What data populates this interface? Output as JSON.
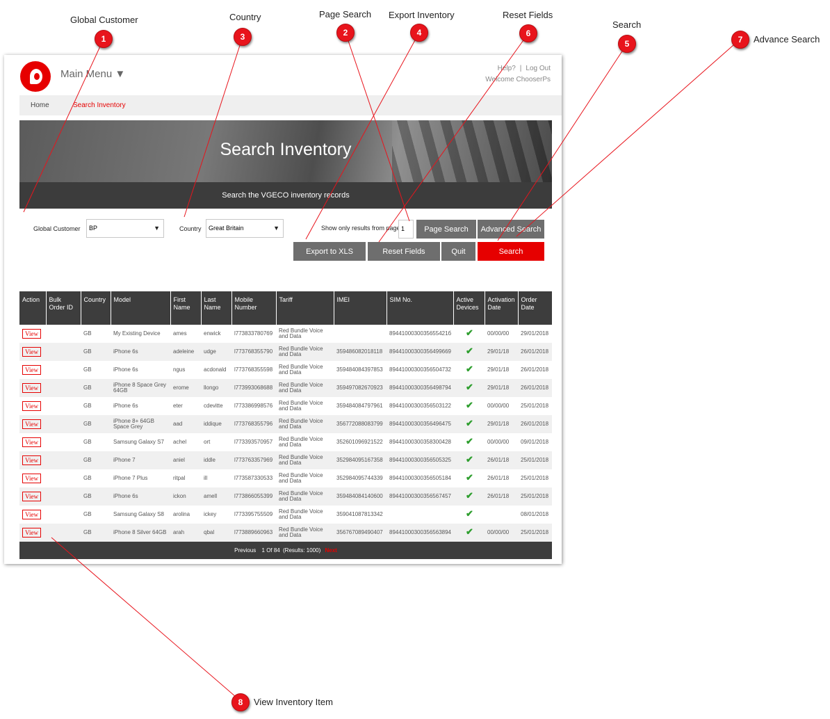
{
  "annotations": [
    {
      "num": "1",
      "label": "Global Customer"
    },
    {
      "num": "2",
      "label": "Page Search"
    },
    {
      "num": "3",
      "label": "Country"
    },
    {
      "num": "4",
      "label": "Export Inventory"
    },
    {
      "num": "5",
      "label": "Search"
    },
    {
      "num": "6",
      "label": "Reset Fields"
    },
    {
      "num": "7",
      "label": "Advance Search"
    },
    {
      "num": "8",
      "label": "View Inventory Item"
    }
  ],
  "header": {
    "main_menu": "Main Menu ▼",
    "help": "Help?",
    "separator": "|",
    "logout": "Log Out",
    "welcome": "Welcome ChooserPs"
  },
  "breadcrumb": {
    "home": "Home",
    "current": "Search Inventory"
  },
  "banner": {
    "title": "Search Inventory",
    "subtitle": "Search the VGECO inventory records"
  },
  "filters": {
    "global_customer_label": "Global Customer",
    "global_customer_value": "BP",
    "country_label": "Country",
    "country_value": "Great Britain",
    "page_label": "Show only results from page",
    "page_value": "1",
    "dropdown_arrow": "▼"
  },
  "buttons": {
    "page_search": "Page Search",
    "advanced_search": "Advanced Search",
    "export": "Export to XLS",
    "reset": "Reset Fields",
    "quit": "Quit",
    "search": "Search"
  },
  "table": {
    "headers": [
      "Action",
      "Bulk Order ID",
      "Country",
      "Model",
      "First Name",
      "Last Name",
      "Mobile Number",
      "Tariff",
      "IMEI",
      "SIM No.",
      "Active Devices",
      "Activation Date",
      "Order Date"
    ],
    "view_label": "View",
    "check_glyph": "✔",
    "rows": [
      {
        "bulk": "",
        "country": "GB",
        "model": "My Existing Device",
        "first": "ames",
        "last": "enwick",
        "mobile": "l773833780769",
        "tariff": "Red Bundle Voice and Data",
        "imei": "",
        "sim": "8944100030035655421б",
        "activation": "00/00/00",
        "order": "29/01/2018"
      },
      {
        "bulk": "",
        "country": "GB",
        "model": "iPhone 6s",
        "first": "adeleine",
        "last": "udge",
        "mobile": "l773768355790",
        "tariff": "Red Bundle Voice and Data",
        "imei": "359486082018118",
        "sim": "89441000300356499669",
        "activation": "29/01/18",
        "order": "26/01/2018"
      },
      {
        "bulk": "",
        "country": "GB",
        "model": "iPhone 6s",
        "first": "ngus",
        "last": "acdonald",
        "mobile": "l773768355598",
        "tariff": "Red Bundle Voice and Data",
        "imei": "359484084397853",
        "sim": "89441000300356504732",
        "activation": "29/01/18",
        "order": "26/01/2018"
      },
      {
        "bulk": "",
        "country": "GB",
        "model": "iPhone 8 Space Grey 64GB",
        "first": "erome",
        "last": "llongo",
        "mobile": "l773993068688",
        "tariff": "Red Bundle Voice and Data",
        "imei": "359497082670923",
        "sim": "89441000300356498794",
        "activation": "29/01/18",
        "order": "26/01/2018"
      },
      {
        "bulk": "",
        "country": "GB",
        "model": "iPhone 6s",
        "first": "eter",
        "last": "cdevitte",
        "mobile": "l773386998576",
        "tariff": "Red Bundle Voice and Data",
        "imei": "359484084797961",
        "sim": "89441000300356503122",
        "activation": "00/00/00",
        "order": "25/01/2018"
      },
      {
        "bulk": "",
        "country": "GB",
        "model": "iPhone 8+ 64GB Space Grey",
        "first": "aad",
        "last": "iddique",
        "mobile": "l773768355796",
        "tariff": "Red Bundle Voice and Data",
        "imei": "356772088083799",
        "sim": "89441000300356496475",
        "activation": "29/01/18",
        "order": "26/01/2018"
      },
      {
        "bulk": "",
        "country": "GB",
        "model": "Samsung Galaxy S7",
        "first": "achel",
        "last": "ort",
        "mobile": "l773393570957",
        "tariff": "Red Bundle Voice and Data",
        "imei": "352601096921522",
        "sim": "89441000300358300428",
        "activation": "00/00/00",
        "order": "09/01/2018"
      },
      {
        "bulk": "",
        "country": "GB",
        "model": "iPhone 7",
        "first": "aniel",
        "last": "iddle",
        "mobile": "l773763357969",
        "tariff": "Red Bundle Voice and Data",
        "imei": "352984095167358",
        "sim": "89441000300356505325",
        "activation": "26/01/18",
        "order": "25/01/2018"
      },
      {
        "bulk": "",
        "country": "GB",
        "model": "iPhone 7 Plus",
        "first": "ritpal",
        "last": "ill",
        "mobile": "l773587330533",
        "tariff": "Red Bundle Voice and Data",
        "imei": "352984095744339",
        "sim": "89441000300356505184",
        "activation": "26/01/18",
        "order": "25/01/2018"
      },
      {
        "bulk": "",
        "country": "GB",
        "model": "iPhone 6s",
        "first": "ickon",
        "last": "amell",
        "mobile": "l773866055399",
        "tariff": "Red Bundle Voice and Data",
        "imei": "359484084140600",
        "sim": "89441000300356567457",
        "activation": "26/01/18",
        "order": "25/01/2018"
      },
      {
        "bulk": "",
        "country": "GB",
        "model": "Samsung Galaxy S8",
        "first": "arolina",
        "last": "ickey",
        "mobile": "l773395755509",
        "tariff": "Red Bundle Voice and Data",
        "imei": "359041087813342",
        "sim": "",
        "activation": "",
        "order": "08/01/2018"
      },
      {
        "bulk": "",
        "country": "GB",
        "model": "iPhone 8 Silver 64GB",
        "first": "arah",
        "last": "qbal",
        "mobile": "l773889660963",
        "tariff": "Red Bundle Voice and Data",
        "imei": "356767089490407",
        "sim": "89441000300356563894",
        "activation": "00/00/00",
        "order": "25/01/2018"
      }
    ]
  },
  "pager": {
    "previous": "Previous",
    "info": "1 Of 84",
    "results": "(Results: 1000)",
    "next": "Next"
  },
  "colors": {
    "accent": "#e60000",
    "dark": "#3d3d3d",
    "gray_button": "#6e6e6e"
  }
}
